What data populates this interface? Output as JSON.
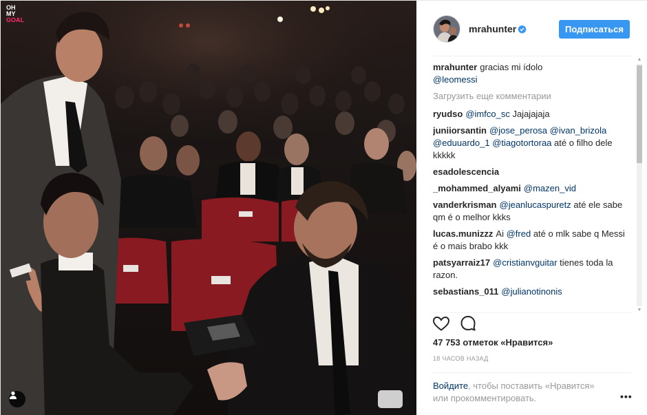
{
  "photo": {
    "logo_line1": "OH",
    "logo_line2": "MY",
    "logo_line3": "GOAL",
    "user_tag_icon": "person-icon"
  },
  "post": {
    "username": "mrahunter",
    "verified_icon": "verified-badge-icon",
    "follow_label": "Подписаться"
  },
  "caption": {
    "user": "mrahunter",
    "text": "gracias mi ídolo ",
    "emoji": "",
    "mention": "@leomessi"
  },
  "load_more": "Загрузить еще комментарии",
  "comments": [
    {
      "user": "ryudso",
      "mention1": "@imfco_sc",
      "text": " Jajajajaja"
    },
    {
      "user": "juniiorsantin",
      "mention1": "@jose_perosa",
      "mention2": "@ivan_brizola",
      "mention3": "@eduuardo_1",
      "mention4": "@tiagotortoraa",
      "text": " até o filho dele kkkkk"
    },
    {
      "user": "esadolescencia",
      "text": ""
    },
    {
      "user": "_mohammed_alyami",
      "mention1": "@mazen_vid",
      "text2": ""
    },
    {
      "user": "vanderkrisman",
      "mention1": "@jeanlucaspuretz",
      "text": " até ele sabe qm é o melhor kkks"
    },
    {
      "user": "lucas.munizzz",
      "text1": "Ai ",
      "mention1": "@fred",
      "text": " até o mlk sabe q Messi é o mais brabo kkk"
    },
    {
      "user": "patsyarraiz17",
      "mention1": "@cristianvguitar",
      "text": " tienes toda la razon."
    },
    {
      "user": "sebastians_011",
      "mention1": "@julianotinonis"
    }
  ],
  "actions": {
    "like_icon": "heart-icon",
    "comment_icon": "comment-bubble-icon",
    "likes": "47 753 отметок «Нравится»",
    "timeago": "18 часов назад"
  },
  "footer": {
    "login_link": "Войдите",
    "login_rest": ", чтобы поставить «Нравится» или прокомментировать.",
    "more_icon": "more-options-icon"
  },
  "colors": {
    "accent": "#3897f0",
    "mention": "#003569",
    "muted": "#999999"
  }
}
